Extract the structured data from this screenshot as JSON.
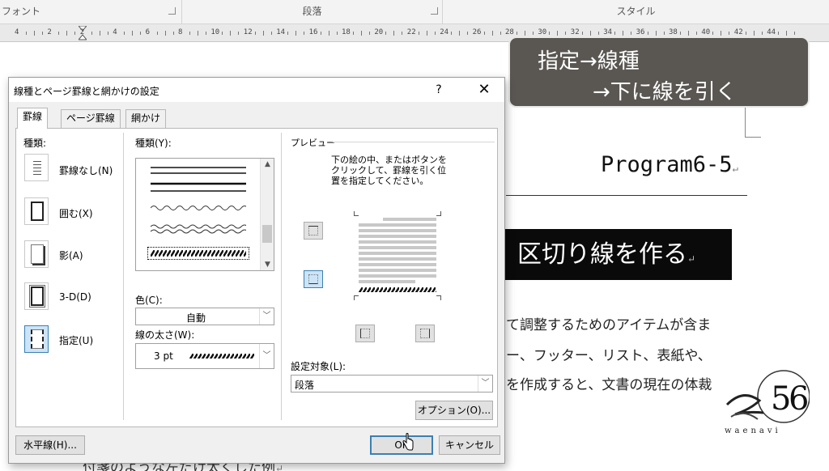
{
  "ribbon": {
    "font_group": "フォント",
    "paragraph_group": "段落",
    "style_group": "スタイル"
  },
  "ruler": {
    "numbers": [
      "4",
      "2",
      "2",
      "4",
      "6",
      "8",
      "10",
      "12",
      "14",
      "16",
      "18",
      "20",
      "22",
      "24",
      "26",
      "28",
      "30",
      "32",
      "34",
      "36",
      "38",
      "40",
      "42",
      "44"
    ]
  },
  "callout": {
    "line1": "指定→線種",
    "line2": "→下に線を引く"
  },
  "document": {
    "title": "Program6-5",
    "heading": "区切り線を作る",
    "para_mark": "↵",
    "text_line1": "て調整するためのアイテムが含ま",
    "text_line2": "ー、フッター、リスト、表紙や、",
    "text_line3": "を作成すると、文書の現在の体裁",
    "bottom_line": "付箋のような左だけ太くした例"
  },
  "logo": {
    "text": "waenavi"
  },
  "dialog": {
    "title": "線種とページ罫線と網かけの設定",
    "help": "?",
    "close": "✕",
    "tabs": [
      {
        "label": "罫線",
        "active": true
      },
      {
        "label": "ページ罫線",
        "active": false
      },
      {
        "label": "網かけ",
        "active": false
      }
    ],
    "setting_label": "種類:",
    "settings": [
      {
        "label": "罫線なし(N)",
        "icon": "no-border-icon",
        "selected": false
      },
      {
        "label": "囲む(X)",
        "icon": "box-border-icon",
        "selected": false
      },
      {
        "label": "影(A)",
        "icon": "shadow-border-icon",
        "selected": false
      },
      {
        "label": "3-D(D)",
        "icon": "3d-border-icon",
        "selected": false
      },
      {
        "label": "指定(U)",
        "icon": "custom-border-icon",
        "selected": true
      }
    ],
    "style_label": "種類(Y):",
    "styles": [
      "double-thin",
      "thick-thin",
      "wavy",
      "double-wavy",
      "diagonal-stripe"
    ],
    "selected_style": 4,
    "color_label": "色(C):",
    "color_value": "自動",
    "width_label": "線の太さ(W):",
    "width_value": "3 pt",
    "preview_label": "プレビュー",
    "preview_instructions": [
      "下の絵の中、またはボタンを",
      "クリックして、罫線を引く位",
      "置を指定してください。"
    ],
    "apply_to_label": "設定対象(L):",
    "apply_to_value": "段落",
    "options_button": "オプション(O)...",
    "horizontal_line_button": "水平線(H)...",
    "ok_button": "OK",
    "cancel_button": "キャンセル",
    "accent_color": "#3c7fb1"
  }
}
